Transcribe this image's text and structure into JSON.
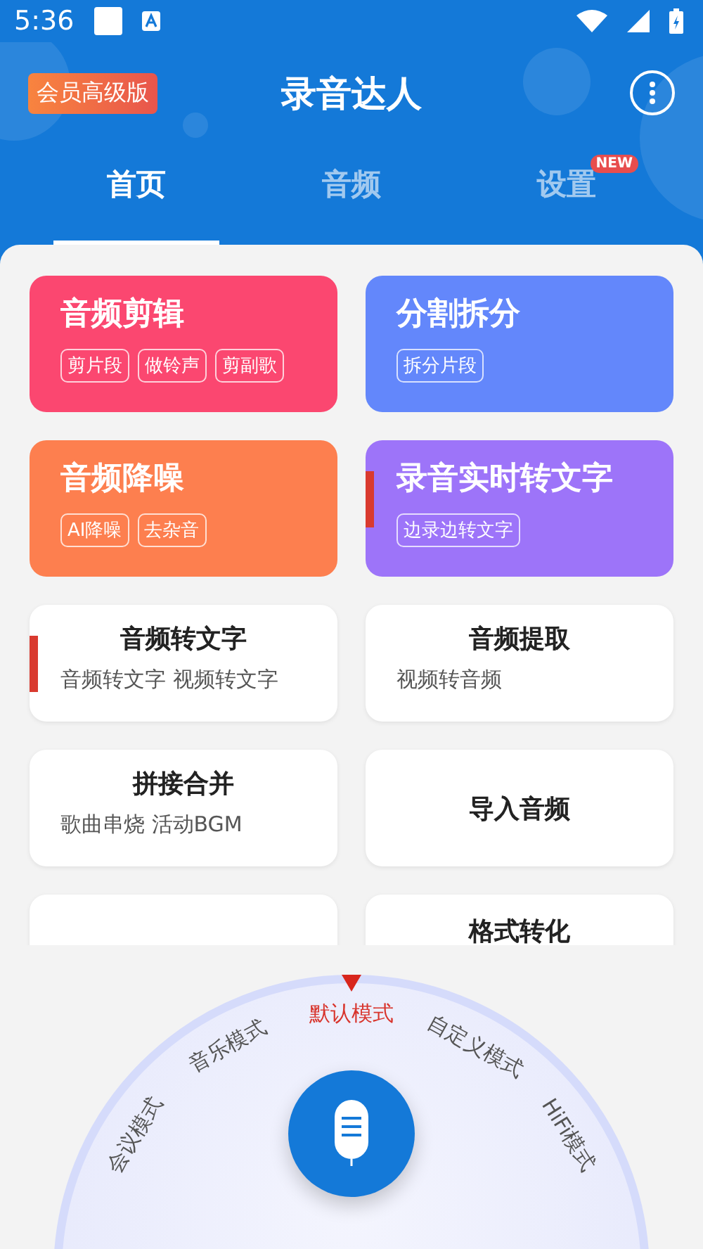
{
  "status_bar": {
    "time": "5:36"
  },
  "header": {
    "vip_badge": "会员高级版",
    "title": "录音达人"
  },
  "tabs": [
    {
      "label": "首页",
      "selected": true
    },
    {
      "label": "音频",
      "selected": false
    },
    {
      "label": "设置",
      "selected": false,
      "badge": "NEW"
    }
  ],
  "cards": [
    {
      "kind": "color",
      "title": "音频剪辑",
      "color": "#fb4770",
      "marked": false,
      "tags": [
        "剪片段",
        "做铃声",
        "剪副歌"
      ]
    },
    {
      "kind": "color",
      "title": "分割拆分",
      "color": "#6387fb",
      "marked": false,
      "tags": [
        "拆分片段"
      ]
    },
    {
      "kind": "color",
      "title": "音频降噪",
      "color": "#fd7f4f",
      "marked": false,
      "tags": [
        "AI降噪",
        "去杂音"
      ]
    },
    {
      "kind": "color",
      "title": "录音实时转文字",
      "color": "#9d74f9",
      "marked": true,
      "tags": [
        "边录边转文字"
      ]
    },
    {
      "kind": "plain",
      "title": "音频转文字",
      "subtitle": "音频转文字 视频转文字",
      "marked": true
    },
    {
      "kind": "plain",
      "title": "音频提取",
      "subtitle": "视频转音频",
      "marked": false
    },
    {
      "kind": "plain",
      "title": "拼接合并",
      "subtitle": "歌曲串烧  活动BGM",
      "marked": false
    },
    {
      "kind": "plain",
      "title": "导入音频",
      "marked": false
    },
    {
      "kind": "plain",
      "marked": false
    },
    {
      "kind": "plain",
      "title": "格式转化",
      "marked": false
    }
  ],
  "mode_dial": {
    "modes": [
      {
        "label": "会议模式",
        "selected": false
      },
      {
        "label": "音乐模式",
        "selected": false
      },
      {
        "label": "默认模式",
        "selected": true
      },
      {
        "label": "自定义模式",
        "selected": false
      },
      {
        "label": "HiFi模式",
        "selected": false
      }
    ]
  }
}
